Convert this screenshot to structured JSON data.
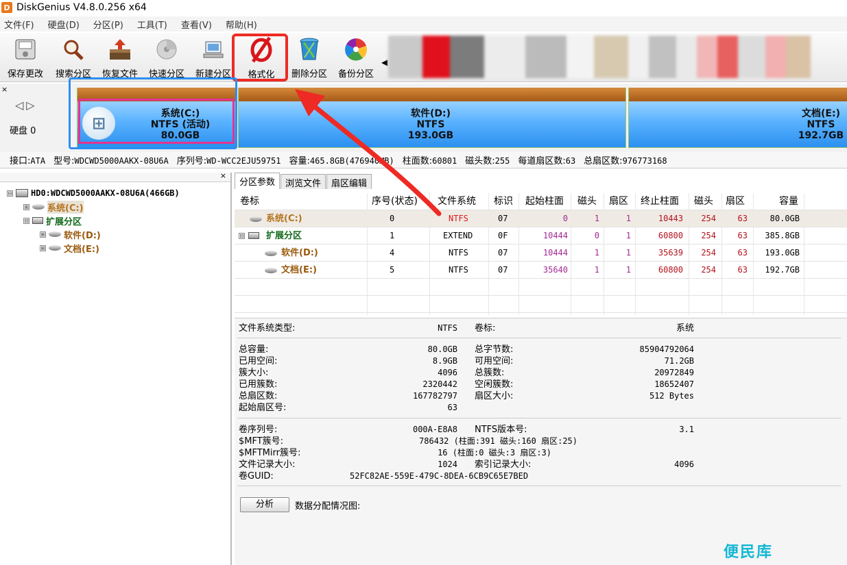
{
  "app": {
    "title": "DiskGenius V4.8.0.256 x64",
    "icon_glyph": "D"
  },
  "menu": [
    "文件(F)",
    "硬盘(D)",
    "分区(P)",
    "工具(T)",
    "查看(V)",
    "帮助(H)"
  ],
  "toolbar": {
    "buttons": [
      "保存更改",
      "搜索分区",
      "恢复文件",
      "快速分区",
      "新建分区",
      "格式化",
      "删除分区",
      "备份分区"
    ],
    "highlight_color": "#ee2a24"
  },
  "nav": {
    "disk_label": "硬盘 0",
    "close": "×",
    "arrows": "◁▷"
  },
  "diskmap": {
    "partitions": [
      {
        "name": "系统(C:)",
        "fs": "NTFS (活动)",
        "size": "80.0GB",
        "logo": "⊞"
      },
      {
        "name": "软件(D:)",
        "fs": "NTFS",
        "size": "193.0GB"
      },
      {
        "name": "文档(E:)",
        "fs": "NTFS",
        "size": "192.7GB"
      }
    ],
    "selected_color": "#e4338e",
    "highlight_color": "#2b8ff3"
  },
  "disk_info": [
    {
      "label": "接口:",
      "value": "ATA"
    },
    {
      "label": "型号:",
      "value": "WDCWD5000AAKX-08U6A"
    },
    {
      "label": "序列号:",
      "value": "WD-WCC2EJU59751"
    },
    {
      "label": "容量:",
      "value": "465.8GB(476940MB)"
    },
    {
      "label": "柱面数:",
      "value": "60801"
    },
    {
      "label": "磁头数:",
      "value": "255"
    },
    {
      "label": "每道扇区数:",
      "value": "63"
    },
    {
      "label": "总扇区数:",
      "value": "976773168"
    }
  ],
  "tree": {
    "close": "×",
    "disk": "HD0:WDCWD5000AAKX-08U6A(466GB)",
    "items": [
      "系统(C:)",
      "扩展分区",
      "软件(D:)",
      "文档(E:)"
    ],
    "expanders": [
      "⊟",
      "⊞",
      "⊟",
      "⊞",
      "⊞"
    ]
  },
  "tabs": [
    "分区参数",
    "浏览文件",
    "扇区编辑"
  ],
  "partition_table": {
    "headers": [
      "卷标",
      "序号(状态)",
      "文件系统",
      "标识",
      "起始柱面",
      "磁头",
      "扇区",
      "终止柱面",
      "磁头",
      "扇区",
      "容量"
    ],
    "rows": [
      [
        "系统(C:)",
        "0",
        "NTFS",
        "07",
        "0",
        "1",
        "1",
        "10443",
        "254",
        "63",
        "80.0GB"
      ],
      [
        "扩展分区",
        "1",
        "EXTEND",
        "0F",
        "10444",
        "0",
        "1",
        "60800",
        "254",
        "63",
        "385.8GB"
      ],
      [
        "软件(D:)",
        "4",
        "NTFS",
        "07",
        "10444",
        "1",
        "1",
        "35639",
        "254",
        "63",
        "193.0GB"
      ],
      [
        "文档(E:)",
        "5",
        "NTFS",
        "07",
        "35640",
        "1",
        "1",
        "60800",
        "254",
        "63",
        "192.7GB"
      ]
    ],
    "expand_glyph": "⊟"
  },
  "details": {
    "fs_type_label": "文件系统类型:",
    "fs_type": "NTFS",
    "volume_label_label": "卷标:",
    "volume_label": "系统",
    "left": [
      {
        "label": "总容量:",
        "value": "80.0GB"
      },
      {
        "label": "已用空间:",
        "value": "8.9GB"
      },
      {
        "label": "簇大小:",
        "value": "4096"
      },
      {
        "label": "已用簇数:",
        "value": "2320442"
      },
      {
        "label": "总扇区数:",
        "value": "167782797"
      },
      {
        "label": "起始扇区号:",
        "value": "63"
      }
    ],
    "right": [
      {
        "label": "总字节数:",
        "value": "85904792064"
      },
      {
        "label": "可用空间:",
        "value": "71.2GB"
      },
      {
        "label": "总簇数:",
        "value": "20972849"
      },
      {
        "label": "空闲簇数:",
        "value": "18652407"
      },
      {
        "label": "扇区大小:",
        "value": "512 Bytes"
      }
    ],
    "serial_label": "卷序列号:",
    "serial": "000A-E8A8",
    "ntfs_ver_label": "NTFS版本号:",
    "ntfs_ver": "3.1",
    "mft_label": "$MFT簇号:",
    "mft": "786432 (柱面:391 磁头:160 扇区:25)",
    "mftmirr_label": "$MFTMirr簇号:",
    "mftmirr": "16 (柱面:0 磁头:3 扇区:3)",
    "record_label": "文件记录大小:",
    "record": "1024",
    "index_label": "索引记录大小:",
    "index": "4096",
    "guid_label": "卷GUID:",
    "guid": "52FC82AE-559E-479C-8DEA-6CB9C65E7BED",
    "analyze_button": "分析",
    "analyze_label": "数据分配情况图:"
  },
  "watermark": "便民库",
  "annotation": {
    "arrow_color": "#ee2a24"
  }
}
